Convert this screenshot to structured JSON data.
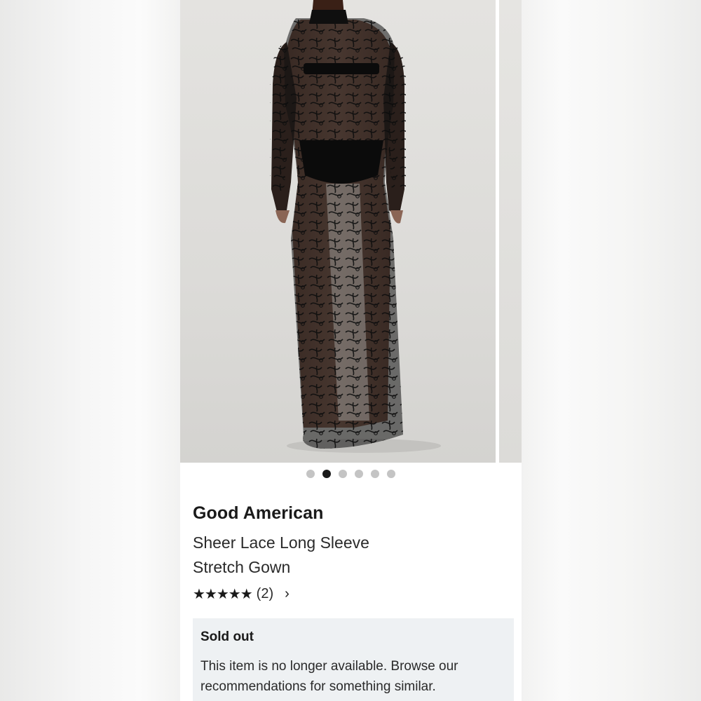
{
  "product": {
    "brand": "Good American",
    "title": "Sheer Lace Long Sleeve Stretch Gown",
    "rating": {
      "stars": "★★★★★",
      "value": 5,
      "count_label": "(2)",
      "chevron": "›"
    }
  },
  "carousel": {
    "total_slides": 6,
    "active_index": 1,
    "image_description_icon": "product-photo"
  },
  "availability": {
    "status": "Sold out",
    "message": "This item is no longer available. Browse our recommendations for something similar."
  },
  "colors": {
    "page_bg": "#f0f0ef",
    "card_bg": "#ffffff",
    "notice_bg": "#eef1f3",
    "dot_active": "#1a1a1a",
    "dot_inactive": "#c4c4c4"
  }
}
